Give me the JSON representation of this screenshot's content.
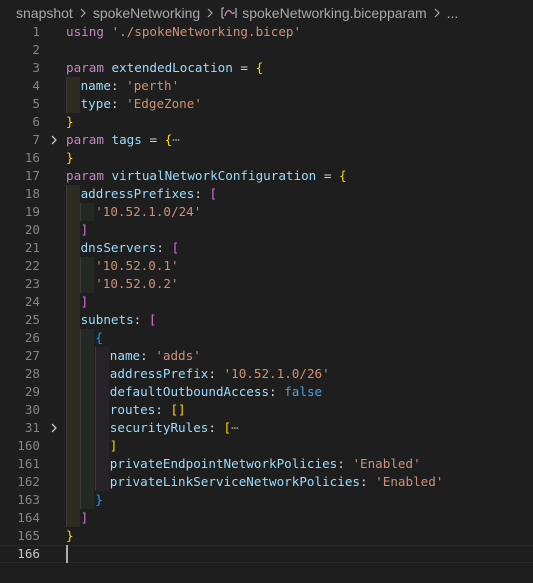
{
  "breadcrumb": {
    "items": [
      "snapshot",
      "spokeNetworking",
      "spokeNetworking.bicepparam",
      "..."
    ]
  },
  "colors": {
    "background": "#1e1e1e",
    "keyword": "#c586c0",
    "string": "#ce9178",
    "identifier": "#9cdcfe",
    "bracket_level1": "#ffd700",
    "bracket_level2": "#da70d6",
    "bracket_level3": "#179fff"
  },
  "icons": {
    "separator": "chevron-right-icon",
    "file": "bicep-param-icon",
    "fold": "chevron-right-icon"
  },
  "editor": {
    "lines": [
      {
        "num": "1",
        "parts": [
          "using",
          " ",
          "'./spokeNetworking.bicep'"
        ]
      },
      {
        "num": "2",
        "parts": []
      },
      {
        "num": "3",
        "parts": [
          "param",
          " ",
          "extendedLocation",
          " = ",
          "{"
        ]
      },
      {
        "num": "4",
        "parts": [
          "name",
          ": ",
          "'perth'"
        ]
      },
      {
        "num": "5",
        "parts": [
          "type",
          ": ",
          "'EdgeZone'"
        ]
      },
      {
        "num": "6",
        "parts": [
          "}"
        ]
      },
      {
        "num": "7",
        "parts": [
          "param",
          " ",
          "tags",
          " = ",
          "{",
          "⋯"
        ]
      },
      {
        "num": "16",
        "parts": [
          "}"
        ]
      },
      {
        "num": "17",
        "parts": [
          "param",
          " ",
          "virtualNetworkConfiguration",
          " = ",
          "{"
        ]
      },
      {
        "num": "18",
        "parts": [
          "addressPrefixes",
          ": ",
          "["
        ]
      },
      {
        "num": "19",
        "parts": [
          "'10.52.1.0/24'"
        ]
      },
      {
        "num": "20",
        "parts": [
          "]"
        ]
      },
      {
        "num": "21",
        "parts": [
          "dnsServers",
          ": ",
          "["
        ]
      },
      {
        "num": "22",
        "parts": [
          "'10.52.0.1'"
        ]
      },
      {
        "num": "23",
        "parts": [
          "'10.52.0.2'"
        ]
      },
      {
        "num": "24",
        "parts": [
          "]"
        ]
      },
      {
        "num": "25",
        "parts": [
          "subnets",
          ": ",
          "["
        ]
      },
      {
        "num": "26",
        "parts": [
          "{"
        ]
      },
      {
        "num": "27",
        "parts": [
          "name",
          ": ",
          "'adds'"
        ]
      },
      {
        "num": "28",
        "parts": [
          "addressPrefix",
          ": ",
          "'10.52.1.0/26'"
        ]
      },
      {
        "num": "29",
        "parts": [
          "defaultOutboundAccess",
          ": ",
          "false"
        ]
      },
      {
        "num": "30",
        "parts": [
          "routes",
          ": ",
          "[]"
        ]
      },
      {
        "num": "31",
        "parts": [
          "securityRules",
          ": ",
          "[",
          "⋯"
        ]
      },
      {
        "num": "160",
        "parts": [
          "]"
        ]
      },
      {
        "num": "161",
        "parts": [
          "privateEndpointNetworkPolicies",
          ": ",
          "'Enabled'"
        ]
      },
      {
        "num": "162",
        "parts": [
          "privateLinkServiceNetworkPolicies",
          ": ",
          "'Enabled'"
        ]
      },
      {
        "num": "163",
        "parts": [
          "}"
        ]
      },
      {
        "num": "164",
        "parts": [
          "]"
        ]
      },
      {
        "num": "165",
        "parts": [
          "}"
        ]
      },
      {
        "num": "166",
        "parts": []
      }
    ]
  }
}
